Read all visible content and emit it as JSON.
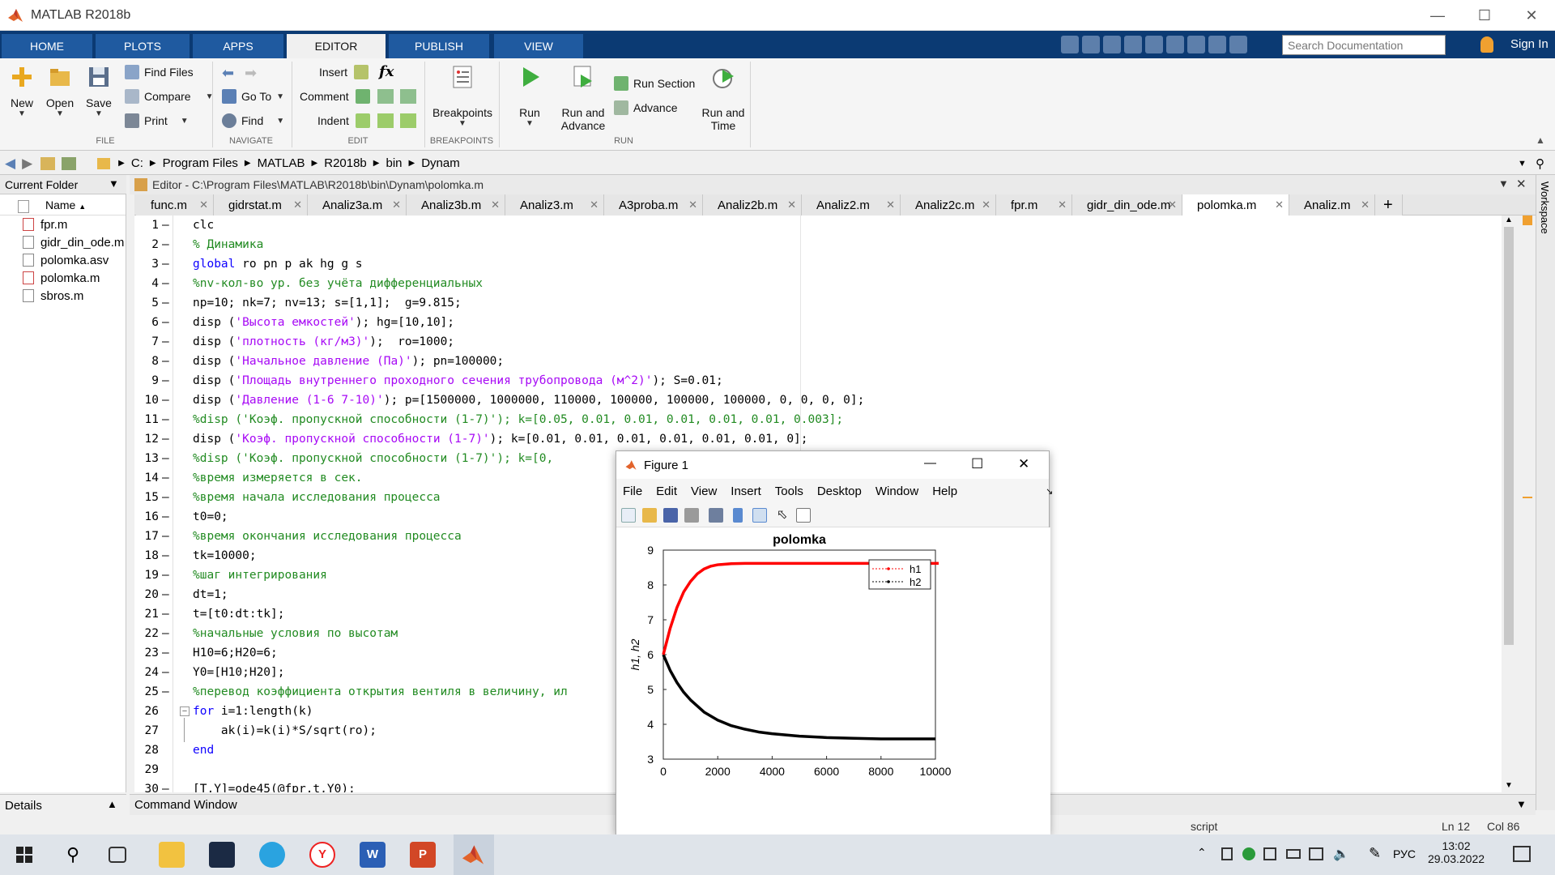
{
  "window": {
    "title": "MATLAB R2018b"
  },
  "ribbon_tabs": [
    "HOME",
    "PLOTS",
    "APPS",
    "EDITOR",
    "PUBLISH",
    "VIEW"
  ],
  "search": {
    "placeholder": "Search Documentation"
  },
  "signin": "Sign In",
  "ribbon": {
    "file": {
      "new": "New",
      "open": "Open",
      "save": "Save",
      "find_files": "Find Files",
      "compare": "Compare",
      "print": "Print",
      "group": "FILE"
    },
    "navigate": {
      "go_to": "Go To",
      "find": "Find",
      "group": "NAVIGATE"
    },
    "edit": {
      "insert": "Insert",
      "comment": "Comment",
      "indent": "Indent",
      "fx": "fx",
      "group": "EDIT"
    },
    "breakpoints": {
      "label": "Breakpoints",
      "group": "BREAKPOINTS"
    },
    "run": {
      "run": "Run",
      "run_and_advance_1": "Run and",
      "run_and_advance_2": "Advance",
      "run_section": "Run Section",
      "advance": "Advance",
      "run_and_time_1": "Run and",
      "run_and_time_2": "Time",
      "group": "RUN"
    }
  },
  "path": [
    "C:",
    "Program Files",
    "MATLAB",
    "R2018b",
    "bin",
    "Dynam"
  ],
  "current_folder": {
    "title": "Current Folder",
    "name_header": "Name",
    "files": [
      "fpr.m",
      "gidr_din_ode.m",
      "polomka.asv",
      "polomka.m",
      "sbros.m"
    ]
  },
  "details": "Details",
  "editor": {
    "title": "Editor - C:\\Program Files\\MATLAB\\R2018b\\bin\\Dynam\\polomka.m",
    "tabs": [
      "func.m",
      "gidrstat.m",
      "Analiz3a.m",
      "Analiz3b.m",
      "Analiz3.m",
      "A3proba.m",
      "Analiz2b.m",
      "Analiz2.m",
      "Analiz2c.m",
      "fpr.m",
      "gidr_din_ode.m",
      "polomka.m",
      "Analiz.m"
    ],
    "active_tab": "polomka.m",
    "lines": [
      "clc",
      "% Динамика",
      "global ro pn p ak hg g s",
      "%nv-кол-во ур. без учёта дифференциальных",
      "np=10; nk=7; nv=13; s=[1,1];  g=9.815;",
      "disp ('Высота емкостей'); hg=[10,10];",
      "disp ('плотность (кг/м3)');  ro=1000;",
      "disp ('Начальное давление (Па)'); pn=100000;",
      "disp ('Площадь внутреннего проходного сечения трубопровода (м^2)'); S=0.01;",
      "disp ('Давление (1-6 7-10)'); p=[1500000, 1000000, 110000, 100000, 100000, 100000, 0, 0, 0, 0];",
      "%disp ('Коэф. пропускной способности (1-7)'); k=[0.05, 0.01, 0.01, 0.01, 0.01, 0.01, 0.003];",
      "disp ('Коэф. пропускной способности (1-7)'); k=[0.01, 0.01, 0.01, 0.01, 0.01, 0.01, 0];",
      "%disp ('Коэф. пропускной способности (1-7)'); k=[0,",
      "%время измеряется в сек.",
      "%время начала исследования процесса",
      "t0=0;",
      "%время окончания исследования процесса",
      "tk=10000;",
      "%шаг интегрирования",
      "dt=1;",
      "t=[t0:dt:tk];",
      "%начальные условия по высотам",
      "H10=6;H20=6;",
      "Y0=[H10;H20];",
      "%перевод коэффициента открытия вентиля в величину, ил",
      "for i=1:length(k)",
      "    ak(i)=k(i)*S/sqrt(ro);",
      "end",
      "",
      "[T,Y]=ode45(@fpr,t,Y0);"
    ]
  },
  "command_window": "Command Window",
  "status": {
    "mode": "script",
    "ln": "Ln  12",
    "col": "Col  86"
  },
  "workspace_label": "Workspace",
  "figure": {
    "title": "Figure 1",
    "menu": [
      "File",
      "Edit",
      "View",
      "Insert",
      "Tools",
      "Desktop",
      "Window",
      "Help"
    ]
  },
  "chart_data": {
    "type": "line",
    "title": "polomka",
    "xlabel": "",
    "ylabel": "h1, h2",
    "xlim": [
      0,
      10000
    ],
    "ylim": [
      3,
      9
    ],
    "xticks": [
      0,
      2000,
      4000,
      6000,
      8000,
      10000
    ],
    "yticks": [
      3,
      4,
      5,
      6,
      7,
      8,
      9
    ],
    "legend_position": "top-right",
    "series": [
      {
        "name": "h1",
        "color": "#ff0000",
        "x": [
          0,
          250,
          500,
          750,
          1000,
          1250,
          1500,
          1750,
          2000,
          2500,
          3000,
          3500,
          4000,
          5000,
          6000,
          7000,
          8000,
          9000,
          10000
        ],
        "y": [
          6.0,
          6.75,
          7.35,
          7.8,
          8.1,
          8.32,
          8.46,
          8.54,
          8.58,
          8.61,
          8.62,
          8.62,
          8.62,
          8.62,
          8.62,
          8.62,
          8.62,
          8.62,
          8.62
        ]
      },
      {
        "name": "h2",
        "color": "#000000",
        "x": [
          0,
          250,
          500,
          750,
          1000,
          1500,
          2000,
          2500,
          3000,
          3500,
          4000,
          5000,
          6000,
          7000,
          8000,
          9000,
          10000
        ],
        "y": [
          6.0,
          5.55,
          5.2,
          4.92,
          4.7,
          4.35,
          4.12,
          3.96,
          3.86,
          3.78,
          3.73,
          3.66,
          3.62,
          3.6,
          3.58,
          3.58,
          3.58
        ]
      }
    ]
  },
  "taskbar": {
    "time": "13:02",
    "date": "29.03.2022",
    "lang": "РУС"
  }
}
